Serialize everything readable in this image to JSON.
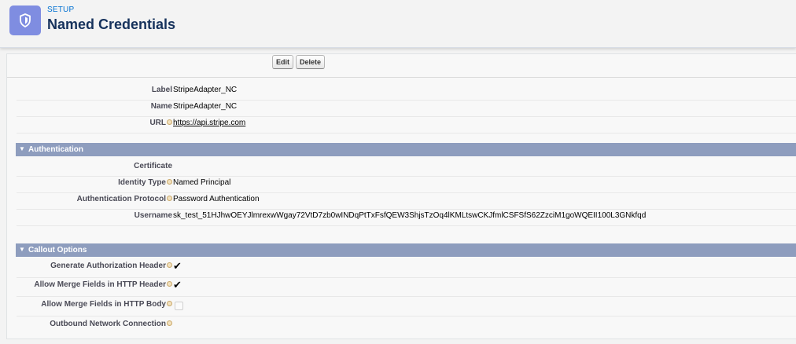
{
  "header": {
    "eyebrow": "SETUP",
    "title": "Named Credentials",
    "icon": "shield-icon",
    "icon_color": "#7f8de1"
  },
  "buttons": {
    "edit": "Edit",
    "delete": "Delete"
  },
  "details": {
    "label_label": "Label",
    "label_value": "StripeAdapter_NC",
    "name_label": "Name",
    "name_value": "StripeAdapter_NC",
    "url_label": "URL",
    "url_value": "https://api.stripe.com"
  },
  "authentication": {
    "section_title": "Authentication",
    "certificate_label": "Certificate",
    "certificate_value": "",
    "identity_type_label": "Identity Type",
    "identity_type_value": "Named Principal",
    "protocol_label": "Authentication Protocol",
    "protocol_value": "Password Authentication",
    "username_label": "Username",
    "username_value": "sk_test_51HJhwOEYJlmrexwWgay72VtD7zb0wINDqPtTxFsfQEW3ShjsTzOq4lKMLtswCKJfmlCSFSfS62ZzciM1goWQEII100L3GNkfqd"
  },
  "callout": {
    "section_title": "Callout Options",
    "gen_auth_header_label": "Generate Authorization Header",
    "gen_auth_header_checked": true,
    "merge_header_label": "Allow Merge Fields in HTTP Header",
    "merge_header_checked": true,
    "merge_body_label": "Allow Merge Fields in HTTP Body",
    "merge_body_checked": false,
    "outbound_label": "Outbound Network Connection",
    "outbound_value": ""
  },
  "colors": {
    "section_bar": "#8e9dbe",
    "title": "#16325c",
    "eyebrow": "#0070d2"
  }
}
